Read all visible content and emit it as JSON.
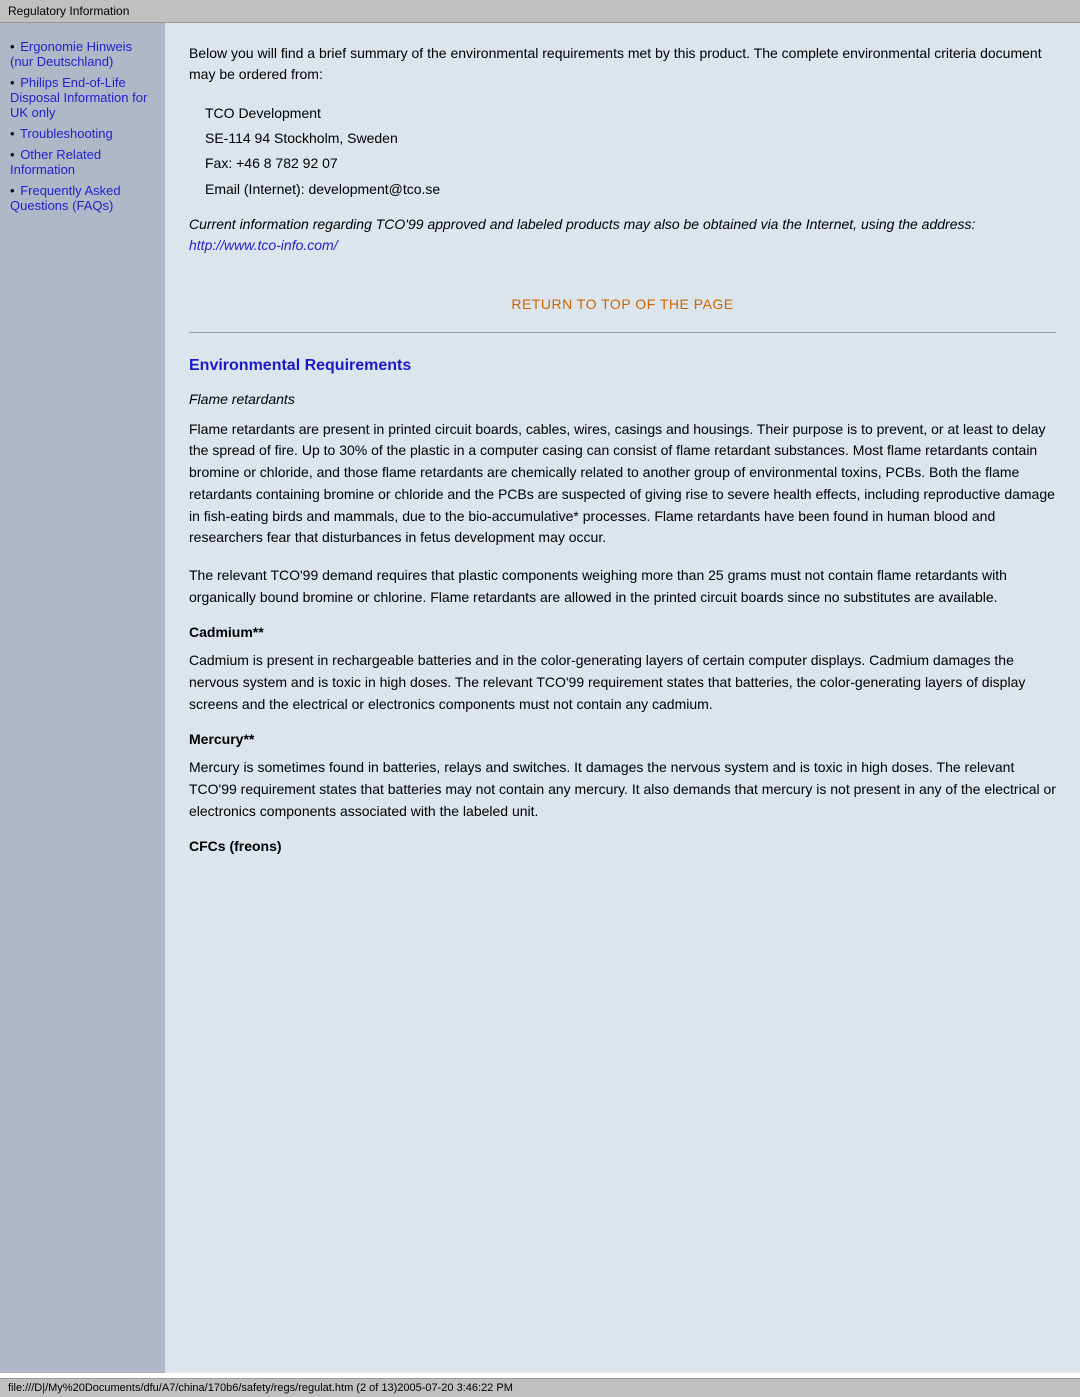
{
  "topbar": {
    "title": "Regulatory Information"
  },
  "sidebar": {
    "items": [
      {
        "label": "Ergonomie Hinweis (nur Deutschland)",
        "href": "#"
      },
      {
        "label": "Philips End-of-Life Disposal Information for UK only",
        "href": "#"
      },
      {
        "label": "Troubleshooting",
        "href": "#"
      },
      {
        "label": "Other Related Information",
        "href": "#"
      },
      {
        "label": "Frequently Asked Questions (FAQs)",
        "href": "#"
      }
    ]
  },
  "content": {
    "intro": "Below you will find a brief summary of the environmental requirements met by this product. The complete environmental criteria document may be ordered from:",
    "address": {
      "line1": "TCO Development",
      "line2": "SE-114 94 Stockholm, Sweden",
      "line3": "Fax: +46 8 782 92 07",
      "line4": "Email (Internet): development@tco.se"
    },
    "italic_note": "Current information regarding TCO'99 approved and labeled products may also be obtained via the Internet, using the address: ",
    "italic_link_text": "http://www.tco-info.com/",
    "italic_link_href": "http://www.tco-info.com/",
    "return_link_label": "RETURN TO TOP OF THE PAGE",
    "env_section_title": "Environmental Requirements",
    "flame_subtitle": "Flame retardants",
    "flame_para1": "Flame retardants are present in printed circuit boards, cables, wires, casings and housings. Their purpose is to prevent, or at least to delay the spread of fire. Up to 30% of the plastic in a computer casing can consist of flame retardant substances. Most flame retardants contain bromine or chloride, and those flame retardants are chemically related to another group of environmental toxins, PCBs. Both the flame retardants containing bromine or chloride and the PCBs are suspected of giving rise to severe health effects, including reproductive damage in fish-eating birds and mammals, due to the bio-accumulative* processes. Flame retardants have been found in human blood and researchers fear that disturbances in fetus development may occur.",
    "flame_para2": "The relevant TCO'99 demand requires that plastic components weighing more than 25 grams must not contain flame retardants with organically bound bromine or chlorine. Flame retardants are allowed in the printed circuit boards since no substitutes are available.",
    "cadmium_heading": "Cadmium**",
    "cadmium_para": "Cadmium is present in rechargeable batteries and in the color-generating layers of certain computer displays. Cadmium damages the nervous system and is toxic in high doses. The relevant TCO'99 requirement states that batteries, the color-generating layers of display screens and the electrical or electronics components must not contain any cadmium.",
    "mercury_heading": "Mercury**",
    "mercury_para": "Mercury is sometimes found in batteries, relays and switches. It damages the nervous system and is toxic in high doses. The relevant TCO'99 requirement states that batteries may not contain any mercury. It also demands that mercury is not present in any of the electrical or electronics components associated with the labeled unit.",
    "cfcs_heading": "CFCs (freons)"
  },
  "statusbar": {
    "text": "file:///D|/My%20Documents/dfu/A7/china/170b6/safety/regs/regulat.htm (2 of 13)2005-07-20 3:46:22 PM"
  }
}
